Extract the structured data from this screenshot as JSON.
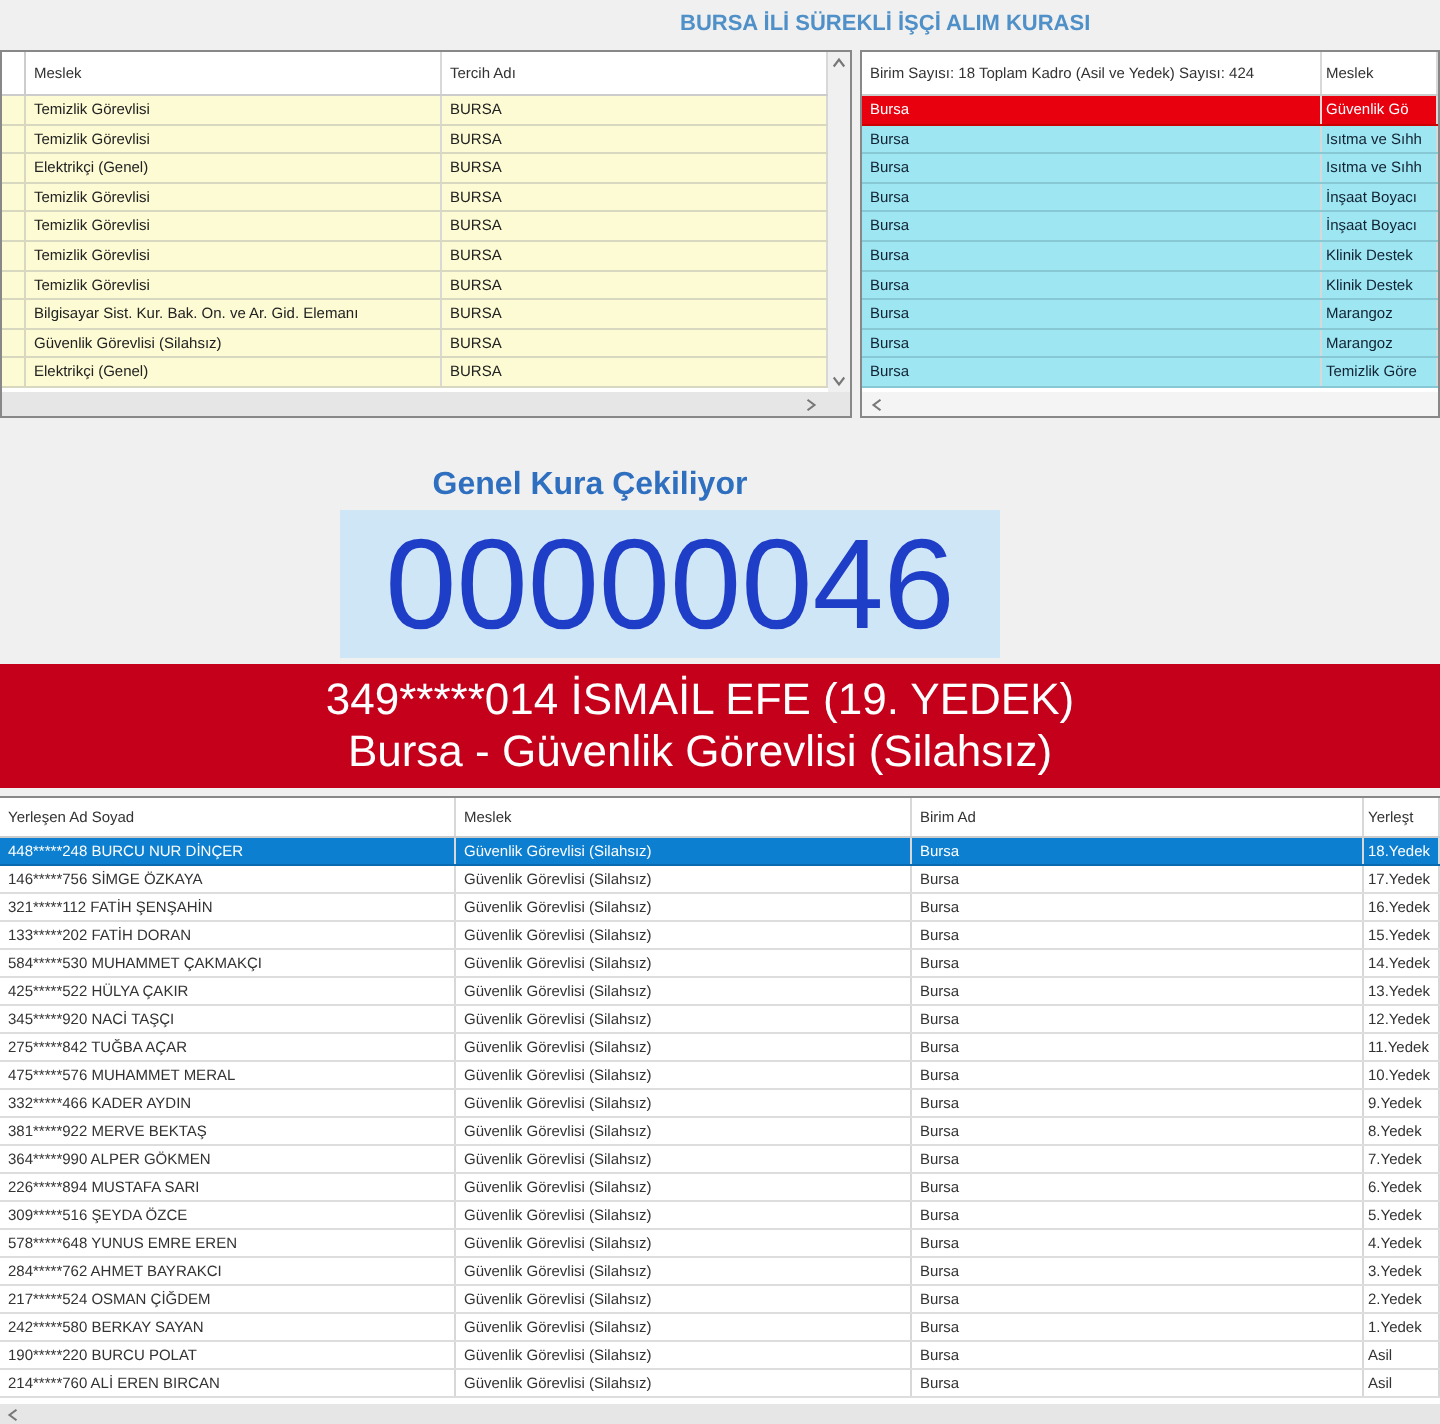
{
  "title": "BURSA İLİ SÜREKLİ İŞÇİ ALIM KURASI",
  "left_table": {
    "columns": [
      "Meslek",
      "Tercih Adı"
    ],
    "rows": [
      {
        "cells": [
          "Temizlik Görevlisi",
          "BURSA"
        ]
      },
      {
        "cells": [
          "Temizlik Görevlisi",
          "BURSA"
        ]
      },
      {
        "cells": [
          "Elektrikçi (Genel)",
          "BURSA"
        ]
      },
      {
        "cells": [
          "Temizlik Görevlisi",
          "BURSA"
        ]
      },
      {
        "cells": [
          "Temizlik Görevlisi",
          "BURSA"
        ]
      },
      {
        "cells": [
          "Temizlik Görevlisi",
          "BURSA"
        ]
      },
      {
        "cells": [
          "Temizlik Görevlisi",
          "BURSA"
        ]
      },
      {
        "cells": [
          "Bilgisayar Sist. Kur. Bak. On. ve Ar. Gid. Elemanı",
          "BURSA"
        ]
      },
      {
        "cells": [
          "Güvenlik Görevlisi (Silahsız)",
          "BURSA"
        ]
      },
      {
        "cells": [
          "Elektrikçi (Genel)",
          "BURSA"
        ]
      }
    ]
  },
  "right_table": {
    "columns": [
      "Birim Sayısı: 18 Toplam Kadro (Asil ve Yedek) Sayısı: 424",
      "Meslek"
    ],
    "rows": [
      {
        "selected": true,
        "cells": [
          "Bursa",
          "Güvenlik Gö"
        ]
      },
      {
        "selected": false,
        "cells": [
          "Bursa",
          "Isıtma ve Sıhh"
        ]
      },
      {
        "selected": false,
        "cells": [
          "Bursa",
          "Isıtma ve Sıhh"
        ]
      },
      {
        "selected": false,
        "cells": [
          "Bursa",
          "İnşaat Boyacı"
        ]
      },
      {
        "selected": false,
        "cells": [
          "Bursa",
          "İnşaat Boyacı"
        ]
      },
      {
        "selected": false,
        "cells": [
          "Bursa",
          "Klinik Destek"
        ]
      },
      {
        "selected": false,
        "cells": [
          "Bursa",
          "Klinik Destek"
        ]
      },
      {
        "selected": false,
        "cells": [
          "Bursa",
          "Marangoz"
        ]
      },
      {
        "selected": false,
        "cells": [
          "Bursa",
          "Marangoz"
        ]
      },
      {
        "selected": false,
        "cells": [
          "Bursa",
          "Temizlik Göre"
        ]
      }
    ]
  },
  "draw": {
    "heading": "Genel Kura Çekiliyor",
    "counter": "00000046",
    "result_line_1": "349*****014 İSMAİL EFE (19. YEDEK)",
    "result_line_2": "Bursa - Güvenlik Görevlisi (Silahsız)"
  },
  "results_table": {
    "columns": [
      "Yerleşen Ad Soyad",
      "Meslek",
      "Birim Ad",
      "Yerleşt"
    ],
    "rows": [
      {
        "selected": true,
        "cells": [
          "448*****248 BURCU NUR DİNÇER",
          "Güvenlik Görevlisi (Silahsız)",
          "Bursa",
          "18.Yedek"
        ]
      },
      {
        "selected": false,
        "cells": [
          "146*****756 SİMGE ÖZKAYA",
          "Güvenlik Görevlisi (Silahsız)",
          "Bursa",
          "17.Yedek"
        ]
      },
      {
        "selected": false,
        "cells": [
          "321*****112 FATİH ŞENŞAHİN",
          "Güvenlik Görevlisi (Silahsız)",
          "Bursa",
          "16.Yedek"
        ]
      },
      {
        "selected": false,
        "cells": [
          "133*****202 FATİH DORAN",
          "Güvenlik Görevlisi (Silahsız)",
          "Bursa",
          "15.Yedek"
        ]
      },
      {
        "selected": false,
        "cells": [
          "584*****530 MUHAMMET ÇAKMAKÇI",
          "Güvenlik Görevlisi (Silahsız)",
          "Bursa",
          "14.Yedek"
        ]
      },
      {
        "selected": false,
        "cells": [
          "425*****522 HÜLYA ÇAKIR",
          "Güvenlik Görevlisi (Silahsız)",
          "Bursa",
          "13.Yedek"
        ]
      },
      {
        "selected": false,
        "cells": [
          "345*****920 NACİ TAŞÇI",
          "Güvenlik Görevlisi (Silahsız)",
          "Bursa",
          "12.Yedek"
        ]
      },
      {
        "selected": false,
        "cells": [
          "275*****842 TUĞBA AÇAR",
          "Güvenlik Görevlisi (Silahsız)",
          "Bursa",
          "11.Yedek"
        ]
      },
      {
        "selected": false,
        "cells": [
          "475*****576 MUHAMMET MERAL",
          "Güvenlik Görevlisi (Silahsız)",
          "Bursa",
          "10.Yedek"
        ]
      },
      {
        "selected": false,
        "cells": [
          "332*****466 KADER AYDIN",
          "Güvenlik Görevlisi (Silahsız)",
          "Bursa",
          "9.Yedek"
        ]
      },
      {
        "selected": false,
        "cells": [
          "381*****922 MERVE BEKTAŞ",
          "Güvenlik Görevlisi (Silahsız)",
          "Bursa",
          "8.Yedek"
        ]
      },
      {
        "selected": false,
        "cells": [
          "364*****990 ALPER GÖKMEN",
          "Güvenlik Görevlisi (Silahsız)",
          "Bursa",
          "7.Yedek"
        ]
      },
      {
        "selected": false,
        "cells": [
          "226*****894 MUSTAFA SARI",
          "Güvenlik Görevlisi (Silahsız)",
          "Bursa",
          "6.Yedek"
        ]
      },
      {
        "selected": false,
        "cells": [
          "309*****516 ŞEYDA ÖZCE",
          "Güvenlik Görevlisi (Silahsız)",
          "Bursa",
          "5.Yedek"
        ]
      },
      {
        "selected": false,
        "cells": [
          "578*****648 YUNUS EMRE EREN",
          "Güvenlik Görevlisi (Silahsız)",
          "Bursa",
          "4.Yedek"
        ]
      },
      {
        "selected": false,
        "cells": [
          "284*****762 AHMET BAYRAKCI",
          "Güvenlik Görevlisi (Silahsız)",
          "Bursa",
          "3.Yedek"
        ]
      },
      {
        "selected": false,
        "cells": [
          "217*****524 OSMAN ÇİĞDEM",
          "Güvenlik Görevlisi (Silahsız)",
          "Bursa",
          "2.Yedek"
        ]
      },
      {
        "selected": false,
        "cells": [
          "242*****580 BERKAY SAYAN",
          "Güvenlik Görevlisi (Silahsız)",
          "Bursa",
          "1.Yedek"
        ]
      },
      {
        "selected": false,
        "cells": [
          "190*****220 BURCU POLAT",
          "Güvenlik Görevlisi (Silahsız)",
          "Bursa",
          "Asil"
        ]
      },
      {
        "selected": false,
        "cells": [
          "214*****760 ALİ EREN BIRCAN",
          "Güvenlik Görevlisi (Silahsız)",
          "Bursa",
          "Asil"
        ]
      }
    ]
  }
}
